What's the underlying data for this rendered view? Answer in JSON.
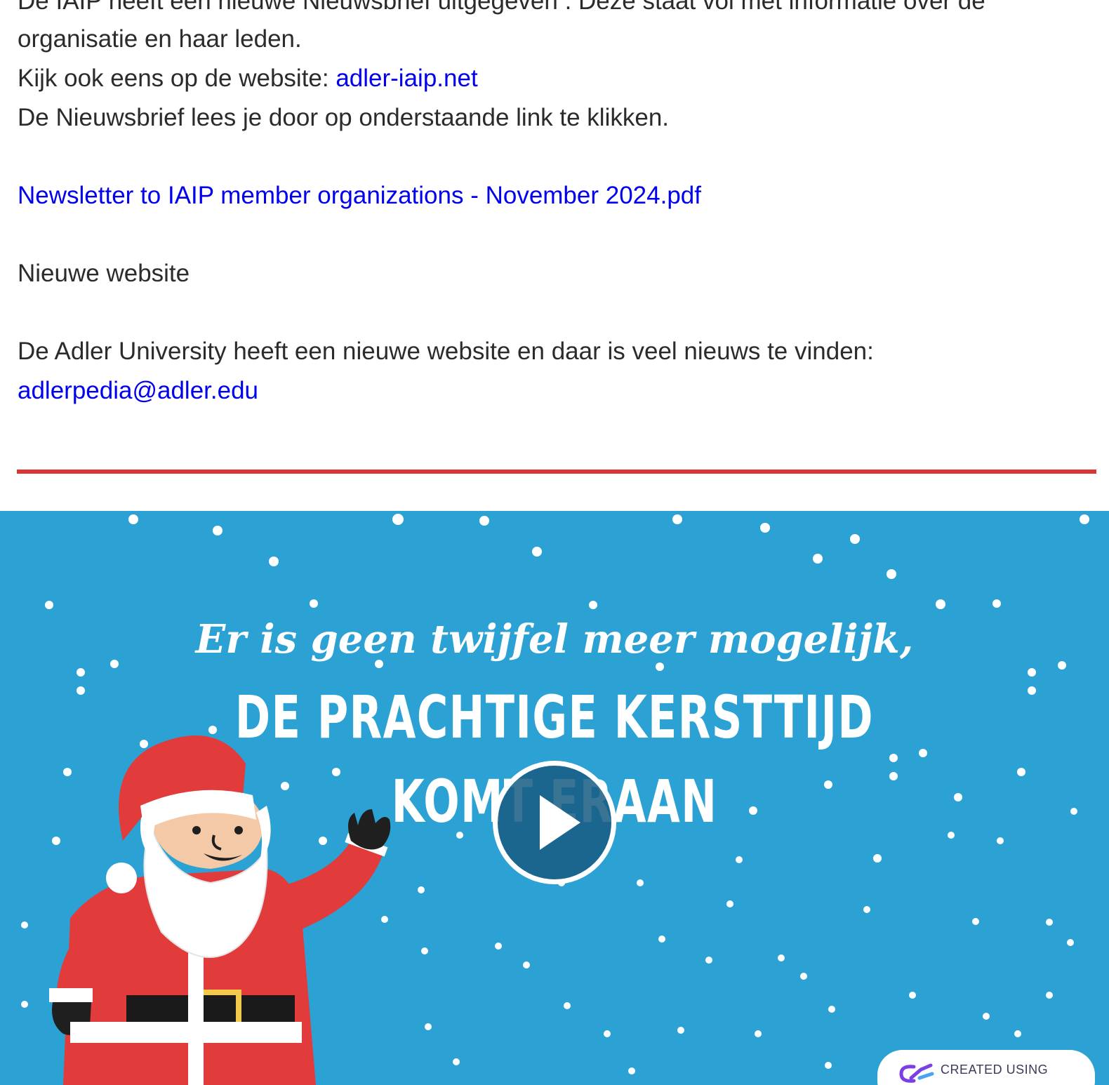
{
  "article": {
    "line1": "De IAIP heeft een nieuwe Nieuwsbrief uitgegeven . Deze staat vol met informatie over de",
    "line2": "organisatie en haar leden.",
    "line3_prefix": "Kijk ook eens op de website: ",
    "website_link": "adler-iaip.net",
    "line4": "De Nieuwsbrief lees je door op onderstaande link te klikken.",
    "newsletter_link": "Newsletter to IAIP member organizations - November 2024.pdf",
    "section_heading": "Nieuwe website",
    "line7": "De Adler University heeft een nieuwe website en daar is veel nieuws te vinden:",
    "email_link": "adlerpedia@adler.edu"
  },
  "video": {
    "headline_top": "Er is geen twijfel meer mogelijk,",
    "headline_mid": "DE PRACHTIGE KERSTTIJD",
    "headline_bottom": "KOMT ERAAN",
    "badge_label": "CREATED USING",
    "play_icon": "play-icon",
    "background_color": "#2ca1d4"
  },
  "colors": {
    "link": "#0000ee",
    "text": "#2b2b2b",
    "divider": "#d93636"
  }
}
